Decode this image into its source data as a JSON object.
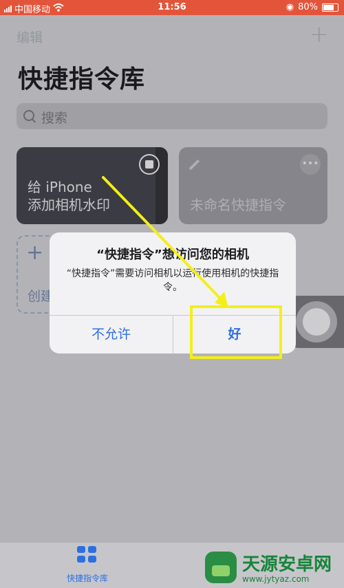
{
  "status_bar": {
    "carrier": "中国移动",
    "time": "11:56",
    "battery_percent": "80%"
  },
  "app": {
    "nav": {
      "edit_label": "编辑",
      "add_symbol": "+"
    },
    "title": "快捷指令库",
    "search": {
      "placeholder": "搜索"
    },
    "cards": [
      {
        "line1": "给 iPhone",
        "line2": "添加相机水印"
      },
      {
        "name": "未命名快捷指令"
      }
    ],
    "create_card": {
      "plus": "+",
      "label": "创建"
    },
    "tab_bar": {
      "items": [
        {
          "label": "快捷指令库",
          "icon": "grid-icon",
          "active": true
        }
      ]
    }
  },
  "dialog": {
    "title": "“快捷指令”想访问您的相机",
    "message": "“快捷指令”需要访问相机以运行使用相机的快捷指令。",
    "buttons": {
      "deny": "不允许",
      "allow": "好"
    }
  },
  "watermark": {
    "site_name": "天源安卓网",
    "site_url": "www.jytyaz.com"
  },
  "colors": {
    "status_bar": "#e2553b",
    "accent_blue": "#2d6fe0",
    "highlight_yellow": "#f3ef1a"
  }
}
